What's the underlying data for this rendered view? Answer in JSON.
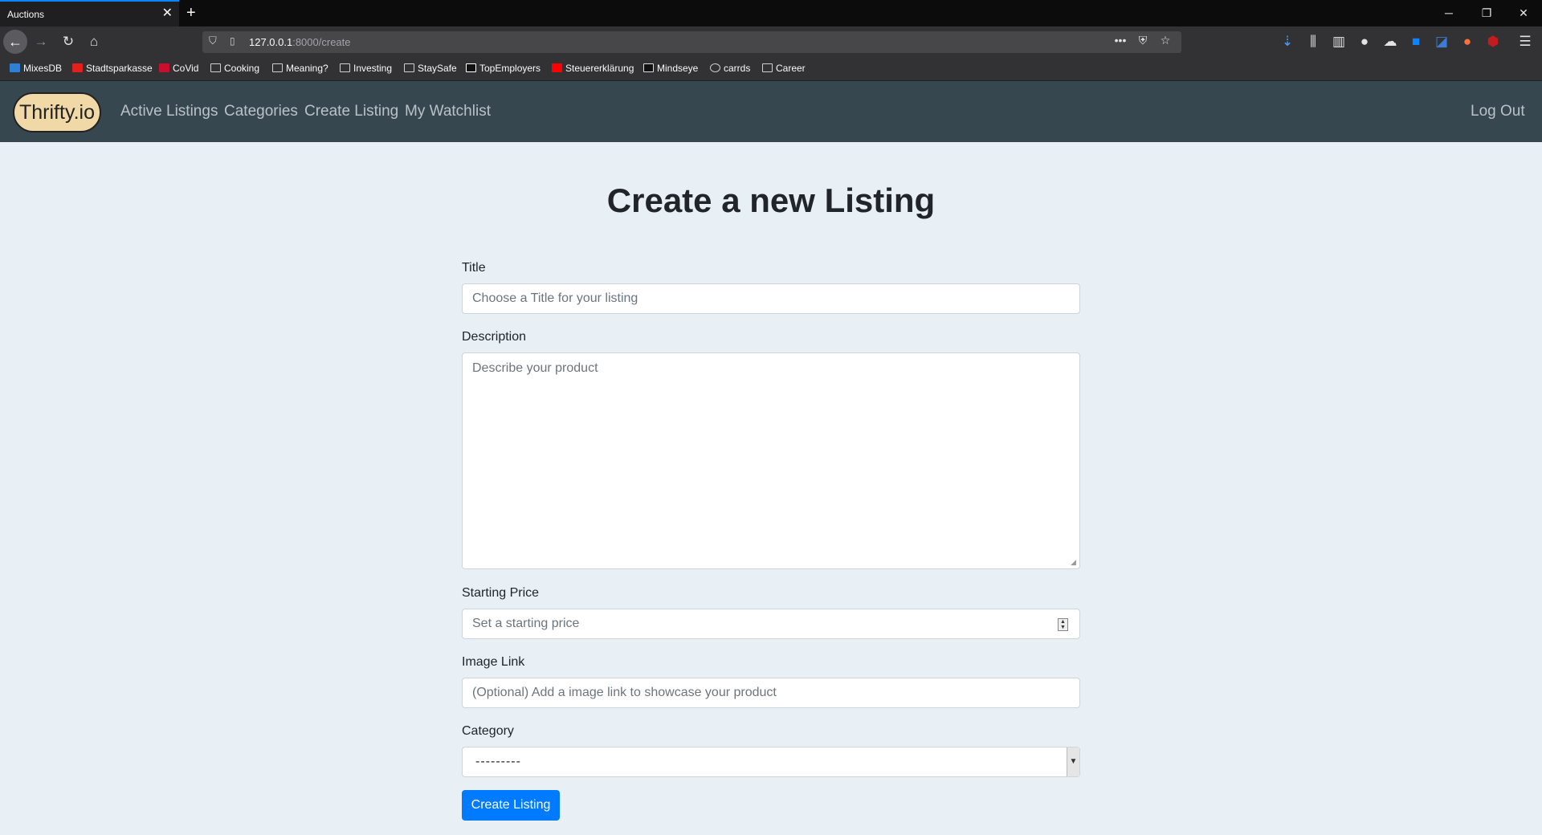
{
  "browser": {
    "tab_title": "Auctions",
    "url_host": "127.0.0.1",
    "url_path": ":8000/create",
    "bookmarks": [
      "MixesDB",
      "Stadtsparkasse",
      "CoVid",
      "Cooking",
      "Meaning?",
      "Investing",
      "StaySafe",
      "TopEmployers",
      "Steuererklärung",
      "Mindseye",
      "carrds",
      "Career"
    ]
  },
  "nav": {
    "brand": "Thrifty.io",
    "links": [
      "Active Listings",
      "Categories",
      "Create Listing",
      "My Watchlist"
    ],
    "logout": "Log Out"
  },
  "form": {
    "heading": "Create a new Listing",
    "title_label": "Title",
    "title_placeholder": "Choose a Title for your listing",
    "description_label": "Description",
    "description_placeholder": "Describe your product",
    "price_label": "Starting Price",
    "price_placeholder": "Set a starting price",
    "image_label": "Image Link",
    "image_placeholder": "(Optional) Add a image link to showcase your product",
    "category_label": "Category",
    "category_value": "---------",
    "submit_label": "Create Listing"
  }
}
